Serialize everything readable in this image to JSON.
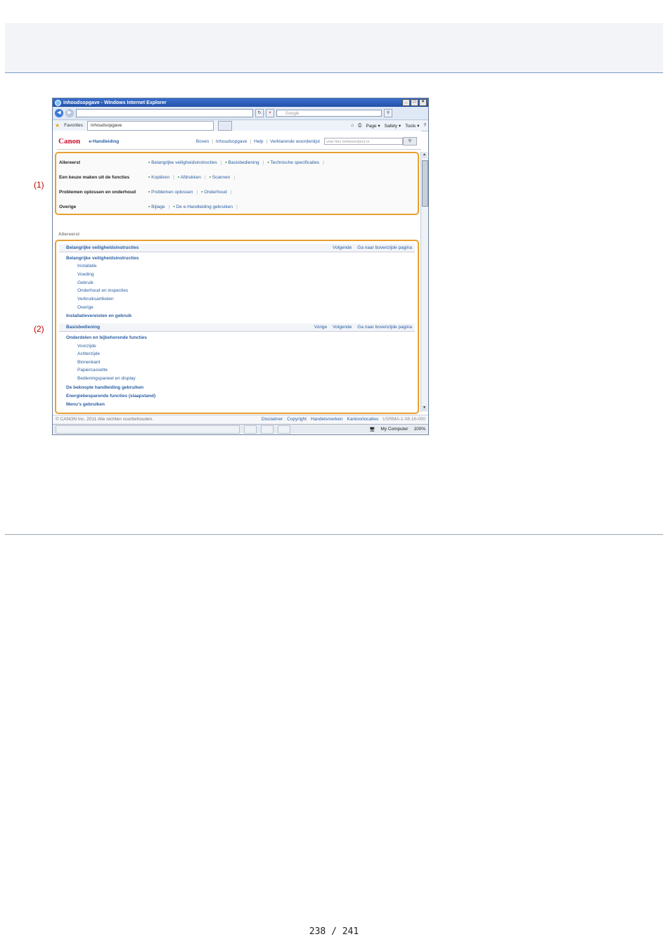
{
  "page": {
    "number": "238 / 241"
  },
  "callouts": [
    "(1)",
    "(2)"
  ],
  "browser": {
    "title": "Inhoudsopgave - Windows Internet Explorer",
    "search_placeholder": "Google",
    "favorites_label": "Favorites",
    "tab_label": "Inhoudsopgave",
    "tools": [
      "Page ▾",
      "Safety ▾",
      "Tools ▾"
    ],
    "window_buttons": [
      "_",
      "□",
      "×"
    ]
  },
  "manual": {
    "logo": "Canon",
    "subtitle": "e-Handleiding",
    "topnav": [
      "Boven",
      "Inhoudsopgave",
      "Help",
      "Verklarende woordenlijst"
    ],
    "search_placeholder": "voer hier trefwoord(en) in",
    "menu_rows": [
      {
        "label": "Allereerst",
        "links": [
          "Belangrijke veiligheidsinstructies",
          "Basisbediening",
          "Technische specificaties"
        ]
      },
      {
        "label": "Een keuze maken uit de functies",
        "links": [
          "Kopiëren",
          "Afdrukken",
          "Scannen"
        ]
      },
      {
        "label": "Problemen oplossen en onderhoud",
        "links": [
          "Problemen oplossen",
          "Onderhoud"
        ]
      },
      {
        "label": "Overige",
        "links": [
          "Bijlage",
          "De e-Handleiding gebruiken"
        ]
      }
    ],
    "section_title": "Allereerst",
    "chapter1": {
      "title": "Belangrijke veiligheidsinstructies",
      "nav": [
        "Volgende",
        "Ga naar bovenzijde pagina"
      ],
      "heading": "Belangrijke veiligheidsinstructies",
      "subitems": [
        "Installatie",
        "Voeding",
        "Gebruik",
        "Onderhoud en inspecties",
        "Verbruiksartikelen",
        "Overige"
      ],
      "next_heading": "Installatievereisten en gebruik"
    },
    "chapter2": {
      "title": "Basisbediening",
      "nav": [
        "Vorige",
        "Volgende",
        "Ga naar bovenzijde pagina"
      ],
      "heading": "Onderdelen en bijbehorende functies",
      "subitems": [
        "Voorzijde",
        "Achterzijde",
        "Binnenkant",
        "Papiercassette",
        "Bedieningspaneel en display"
      ],
      "more": [
        "De beknopte handleiding gebruiken",
        "Energiebesparende functies (slaapstand)",
        "Menu's gebruiken"
      ]
    },
    "footer": {
      "copyright": "© CANON Inc. 2011 Alle rechten voorbehouden.",
      "links": [
        "Disclaimer",
        "Copyright",
        "Handelsmerken",
        "Kantoorlocaties"
      ],
      "code": "USRMA-1-08.16-000"
    }
  },
  "statusbar": {
    "zone": "My Computer",
    "zoom": "100%"
  }
}
